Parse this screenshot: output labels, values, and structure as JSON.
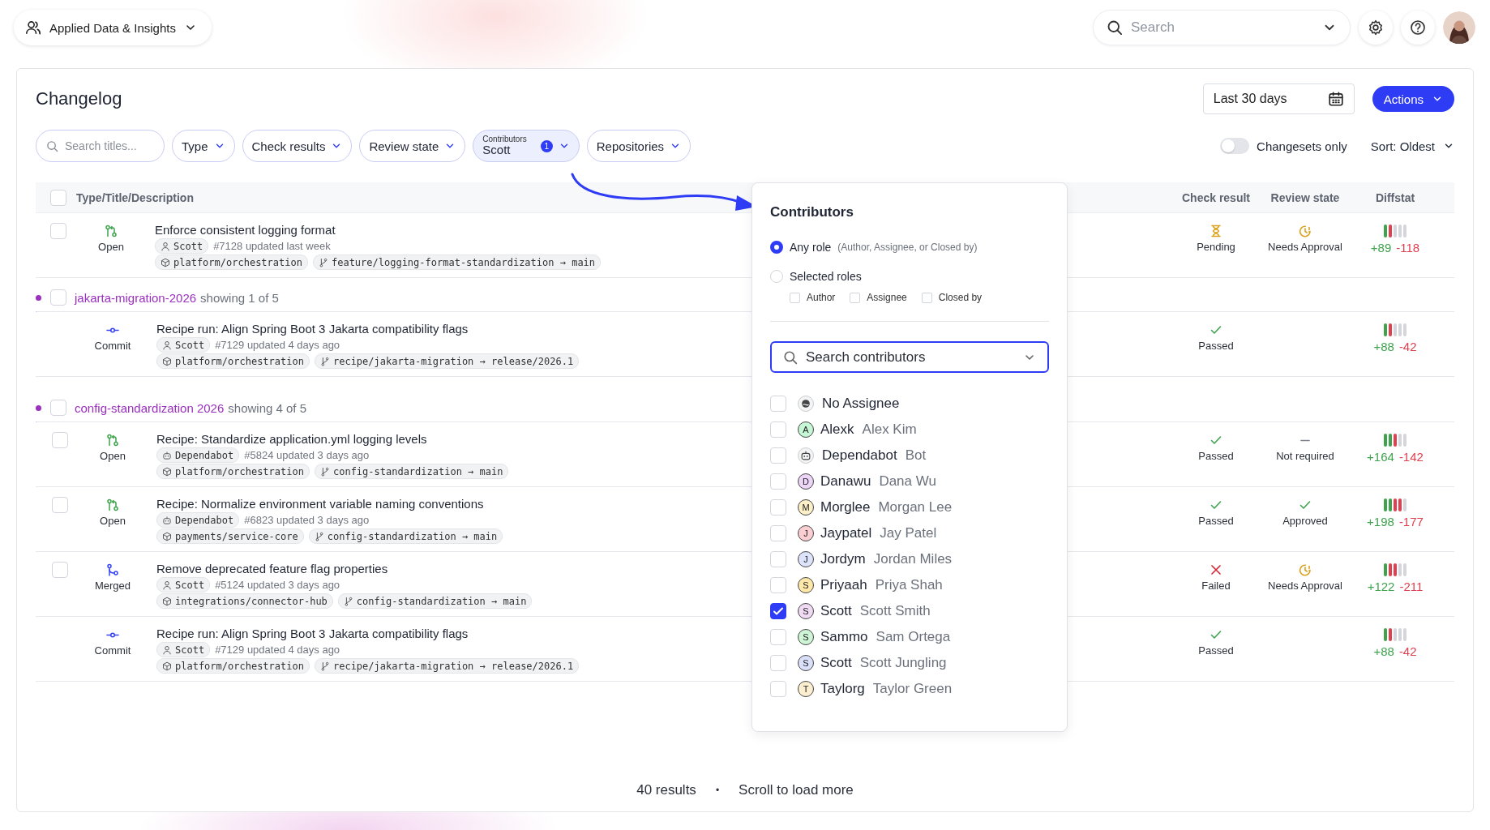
{
  "topbar": {
    "team": "Applied Data & Insights",
    "search": {
      "placeholder": "Search"
    }
  },
  "header": {
    "title": "Changelog",
    "date_range": "Last 30 days",
    "actions": "Actions"
  },
  "filters": {
    "search": {
      "placeholder": "Search titles..."
    },
    "chips": [
      {
        "kind": "plain",
        "label": "Type"
      },
      {
        "kind": "plain",
        "label": "Check results"
      },
      {
        "kind": "plain",
        "label": "Review state"
      },
      {
        "kind": "value",
        "label": "Contributors",
        "value": "Scott",
        "count": "1"
      },
      {
        "kind": "plain",
        "label": "Repositories"
      }
    ],
    "toggle": {
      "label": "Changesets only",
      "on": false
    },
    "sort": "Sort: Oldest"
  },
  "table": {
    "all_checked": false,
    "columns": [
      "Type/Title/Description",
      "Check result",
      "Review  state",
      "Diffstat"
    ],
    "rows": [
      {
        "kind": "open",
        "checked": false,
        "status": "Open",
        "title": "Enforce consistent logging format",
        "author": {
          "kind": "person",
          "name": "Scott"
        },
        "meta": "#7128 updated last week",
        "repo": "platform/orchestration",
        "branch": "feature/logging-format-standardization → main",
        "check": {
          "kind": "pending",
          "label": "Pending"
        },
        "review": {
          "kind": "pending",
          "label": "Needs Approval"
        },
        "bars": [
          {
            "kind": "add"
          },
          {
            "kind": "del"
          },
          {
            "kind": "none"
          },
          {
            "kind": "none"
          },
          {
            "kind": "none"
          }
        ],
        "added": "+89",
        "removed": "-118"
      },
      {
        "kind": "group",
        "checked": false,
        "name": "jakarta-migration-2026",
        "summary": "showing 1 of 5",
        "children": [
          {
            "kind": "commit",
            "status": "Commit",
            "title": "Recipe run: Align Spring Boot 3 Jakarta compatibility flags",
            "author": {
              "kind": "person",
              "name": "Scott"
            },
            "meta": "#7129 updated 4 days ago",
            "repo": "platform/orchestration",
            "branch": "recipe/jakarta-migration → release/2026.1",
            "check": {
              "kind": "passed",
              "label": "Passed"
            },
            "bars": [
              {
                "kind": "add"
              },
              {
                "kind": "del"
              },
              {
                "kind": "none"
              },
              {
                "kind": "none"
              },
              {
                "kind": "none"
              }
            ],
            "added": "+88",
            "removed": "-42"
          }
        ]
      },
      {
        "kind": "group",
        "checked": false,
        "name": "config-standardization 2026",
        "summary": "showing 4 of 5",
        "children": [
          {
            "kind": "open",
            "checked": false,
            "status": "Open",
            "title": "Recipe: Standardize application.yml logging levels",
            "author": {
              "kind": "bot",
              "name": "Dependabot"
            },
            "meta": "#5824 updated 3 days ago",
            "repo": "platform/orchestration",
            "branch": "config-standardization → main",
            "check": {
              "kind": "passed",
              "label": "Passed"
            },
            "review": {
              "kind": "none",
              "label": "Not required"
            },
            "bars": [
              {
                "kind": "add"
              },
              {
                "kind": "add"
              },
              {
                "kind": "del"
              },
              {
                "kind": "none"
              },
              {
                "kind": "none"
              }
            ],
            "added": "+164",
            "removed": "-142"
          },
          {
            "kind": "open",
            "checked": false,
            "status": "Open",
            "title": "Recipe: Normalize environment variable naming conventions",
            "author": {
              "kind": "bot",
              "name": "Dependabot"
            },
            "meta": "#6823 updated 3 days ago",
            "repo": "payments/service-core",
            "branch": "config-standardization → main",
            "check": {
              "kind": "passed",
              "label": "Passed"
            },
            "review": {
              "kind": "approved",
              "label": "Approved"
            },
            "bars": [
              {
                "kind": "add"
              },
              {
                "kind": "add"
              },
              {
                "kind": "del"
              },
              {
                "kind": "del"
              },
              {
                "kind": "none"
              }
            ],
            "added": "+198",
            "removed": "-177"
          },
          {
            "kind": "merged",
            "checked": false,
            "status": "Merged",
            "title": "Remove deprecated feature flag properties",
            "author": {
              "kind": "person",
              "name": "Scott"
            },
            "meta": "#5124 updated 3 days ago",
            "repo": "integrations/connector-hub",
            "branch": "config-standardization → main",
            "check": {
              "kind": "failed",
              "label": "Failed"
            },
            "review": {
              "kind": "pending",
              "label": "Needs Approval"
            },
            "bars": [
              {
                "kind": "add"
              },
              {
                "kind": "del"
              },
              {
                "kind": "del"
              },
              {
                "kind": "none"
              },
              {
                "kind": "none"
              }
            ],
            "added": "+122",
            "removed": "-211"
          },
          {
            "kind": "commit",
            "status": "Commit",
            "title": "Recipe run: Align Spring Boot 3 Jakarta compatibility flags",
            "author": {
              "kind": "person",
              "name": "Scott"
            },
            "meta": "#7129 updated 4 days ago",
            "repo": "platform/orchestration",
            "branch": "recipe/jakarta-migration → release/2026.1",
            "check": {
              "kind": "passed",
              "label": "Passed"
            },
            "bars": [
              {
                "kind": "add"
              },
              {
                "kind": "del"
              },
              {
                "kind": "none"
              },
              {
                "kind": "none"
              },
              {
                "kind": "none"
              }
            ],
            "added": "+88",
            "removed": "-42"
          }
        ]
      }
    ]
  },
  "contributors_popup": {
    "title": "Contributors",
    "roles": [
      {
        "label": "Any role",
        "hint": "(Author, Assignee, or Closed by)",
        "selected": true
      },
      {
        "label": "Selected roles",
        "selected": false
      }
    ],
    "role_filters": [
      {
        "label": "Author",
        "checked": false
      },
      {
        "label": "Assignee",
        "checked": false
      },
      {
        "label": "Closed by",
        "checked": false
      }
    ],
    "search": {
      "placeholder": "Search contributors"
    },
    "people": [
      {
        "kind": "empty",
        "handle": "No Assignee",
        "checked": false
      },
      {
        "kind": "letter",
        "letter": "A",
        "color": "#c6f6d5",
        "handle": "Alexk",
        "name": "Alex Kim",
        "checked": false
      },
      {
        "kind": "bot",
        "handle": "Dependabot",
        "name": "Bot",
        "checked": false
      },
      {
        "kind": "letter",
        "letter": "D",
        "color": "#ecd5f7",
        "handle": "Danawu",
        "name": "Dana Wu",
        "checked": false
      },
      {
        "kind": "letter",
        "letter": "M",
        "color": "#fdf0c8",
        "handle": "Morglee",
        "name": "Morgan Lee",
        "checked": false
      },
      {
        "kind": "letter",
        "letter": "J",
        "color": "#fbcfd2",
        "handle": "Jaypatel",
        "name": "Jay Patel",
        "checked": false
      },
      {
        "kind": "letter",
        "letter": "J",
        "color": "#dde3fb",
        "handle": "Jordym",
        "name": "Jordan Miles",
        "checked": false
      },
      {
        "kind": "letter",
        "letter": "S",
        "color": "#fde7a9",
        "handle": "Priyaah",
        "name": "Priya Shah",
        "checked": false
      },
      {
        "kind": "letter",
        "letter": "S",
        "color": "#efd9f3",
        "handle": "Scott",
        "name": "Scott Smith",
        "checked": true
      },
      {
        "kind": "letter",
        "letter": "S",
        "color": "#cdf5d6",
        "handle": "Sammo",
        "name": "Sam Ortega",
        "checked": false
      },
      {
        "kind": "letter",
        "letter": "S",
        "color": "#dbe0fa",
        "handle": "Scott",
        "name": "Scott Jungling",
        "checked": false
      },
      {
        "kind": "letter",
        "letter": "T",
        "color": "#fbefcf",
        "handle": "Taylorg",
        "name": "Taylor Green",
        "checked": false
      }
    ]
  },
  "footer": {
    "results": "40 results",
    "separator": "•",
    "hint": "Scroll to load more"
  }
}
